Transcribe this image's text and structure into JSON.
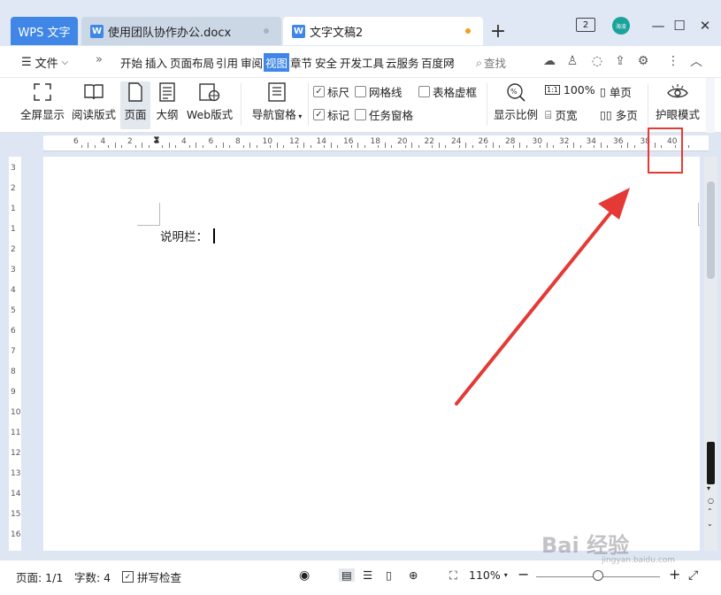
{
  "titlebar": {
    "app_tab": "WPS 文字",
    "tabs": [
      {
        "label": "使用团队协作办公.docx"
      },
      {
        "label": "文字文稿2"
      }
    ],
    "new_tab": "+",
    "tab_count": "2",
    "avatar": "海凌",
    "window_buttons": [
      "—",
      "☐",
      "✕"
    ]
  },
  "menu": {
    "file": "文件",
    "items": [
      "开始",
      "插入",
      "页面布局",
      "引用",
      "审阅",
      "视图",
      "章节",
      "安全",
      "开发工具",
      "云服务",
      "百度网"
    ],
    "search": "查找"
  },
  "ribbon": {
    "fullscreen": "全屏显示",
    "reading": "阅读版式",
    "page": "页面",
    "outline": "大纲",
    "web": "Web版式",
    "nav_pane": "导航窗格",
    "checks": {
      "ruler": "标尺",
      "gridlines": "网格线",
      "table_gridlines": "表格虚框",
      "marks": "标记",
      "task_pane": "任务窗格"
    },
    "zoom_label": "显示比例",
    "zoom_100": "100%",
    "page_width": "页宽",
    "single_page": "单页",
    "multi_page": "多页",
    "eye_mode": "护眼模式"
  },
  "ruler": {
    "numbers": [
      "6",
      "4",
      "2",
      "2",
      "4",
      "6",
      "8",
      "10",
      "12",
      "14",
      "16",
      "18",
      "20",
      "22",
      "24",
      "26",
      "28",
      "30",
      "32",
      "34",
      "36",
      "38",
      "40"
    ]
  },
  "vruler": {
    "numbers": [
      "3",
      "2",
      "1",
      "1",
      "2",
      "3",
      "4",
      "5",
      "6",
      "7",
      "8",
      "9",
      "10",
      "11",
      "12",
      "13",
      "14",
      "15",
      "16"
    ]
  },
  "document": {
    "text": "说明栏："
  },
  "status": {
    "page": "页面: 1/1",
    "words": "字数: 4",
    "spell": "拼写检查",
    "zoom": "110%"
  },
  "watermark": {
    "text": "Bai 经验",
    "sub": "jingyan.baidu.com"
  },
  "colors": {
    "accent": "#3f86e6",
    "highlight_box": "#e53935",
    "annotation_arrow": "#e53935",
    "unsaved_dot": "#f59a23"
  }
}
